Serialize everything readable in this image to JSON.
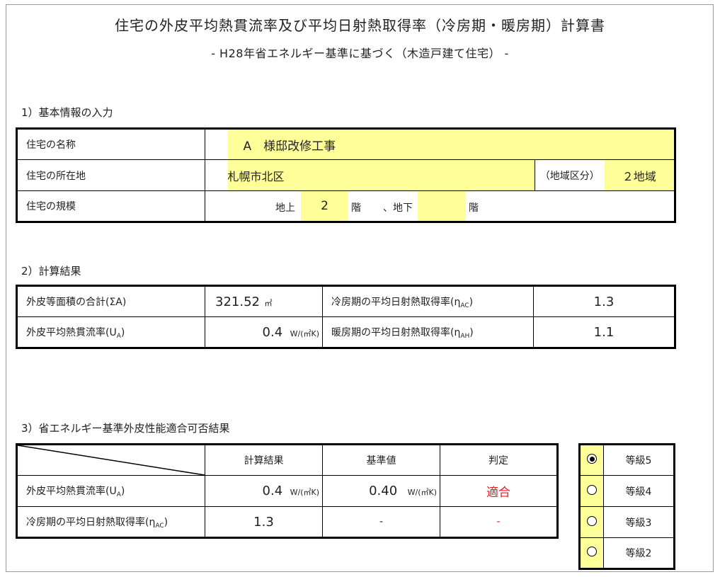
{
  "title": "住宅の外皮平均熱貫流率及び平均日射熱取得率（冷房期・暖房期）計算書",
  "subtitle": "- H28年省エネルギー基準に基づく（木造戸建て住宅） -",
  "section1": {
    "heading": "1）基本情報の入力",
    "name_label": "住宅の名称",
    "name_value": "A　様邸改修工事",
    "location_label": "住宅の所在地",
    "location_value": "札幌市北区",
    "region_label": "（地域区分）",
    "region_value": "２地域",
    "scale_label": "住宅の規模",
    "above_label": "地上",
    "above_value": "2",
    "floor_unit": "階",
    "below_label": "、地下",
    "below_value": "",
    "floor_unit2": "階"
  },
  "section2": {
    "heading": "2）計算結果",
    "area_label": "外皮等面積の合計(ΣA)",
    "area_value": "321.52",
    "area_unit": "㎡",
    "ua_label": "外皮平均熱貫流率(U",
    "ua_sub": "A",
    "ua_value": "0.4",
    "ua_unit": "W/(㎡K)",
    "eac_label": "冷房期の平均日射熱取得率(η",
    "eac_sub": "AC",
    "eac_value": "1.3",
    "eah_label": "暖房期の平均日射熱取得率(η",
    "eah_sub": "AH",
    "eah_value": "1.1"
  },
  "section3": {
    "heading": "3）省エネルギー基準外皮性能適合可否結果",
    "col_result": "計算結果",
    "col_standard": "基準値",
    "col_judge": "判定",
    "row1_label": "外皮平均熱貫流率(U",
    "row1_sub": "A",
    "row1_result": "0.4",
    "row1_result_unit": "W/(㎡K)",
    "row1_standard": "0.40",
    "row1_standard_unit": "W/(㎡K)",
    "row1_judge": "適合",
    "row2_label": "冷房期の平均日射熱取得率(η",
    "row2_sub": "AC",
    "row2_result": "1.3",
    "row2_standard": "-",
    "row2_judge": "-"
  },
  "grades": [
    {
      "label": "等級5",
      "selected": true
    },
    {
      "label": "等級4",
      "selected": false
    },
    {
      "label": "等級3",
      "selected": false
    },
    {
      "label": "等級2",
      "selected": false
    }
  ],
  "colors": {
    "highlight": "#ffff99",
    "judge_red": "#e02020"
  }
}
